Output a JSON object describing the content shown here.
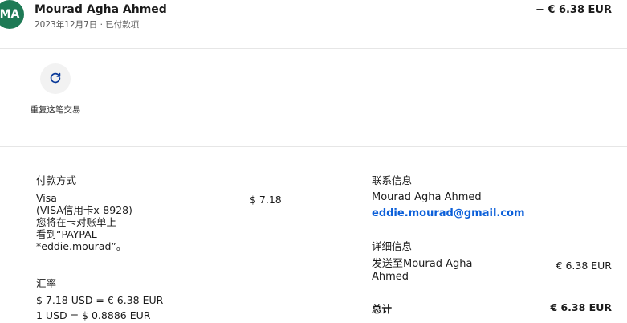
{
  "header": {
    "avatar_initials": "MA",
    "merchant_name": "Mourad Agha Ahmed",
    "meta": "2023年12月7日 · 已付款项",
    "amount": "− € 6.38 EUR"
  },
  "actions": {
    "repeat_label": "重复这笔交易",
    "repeat_icon": "refresh-icon"
  },
  "payment": {
    "title": "付款方式",
    "method_lines": [
      "Visa",
      "(VISA信用卡x-8928)",
      "您将在卡对账单上",
      "看到“PAYPAL",
      "*eddie.mourad”。"
    ],
    "amount": "$ 7.18"
  },
  "exchange": {
    "title": "汇率",
    "line1": "$ 7.18 USD = € 6.38 EUR",
    "line2": "1 USD = $ 0.8886 EUR"
  },
  "contact": {
    "title": "联系信息",
    "name": "Mourad Agha Ahmed",
    "email": "eddie.mourad@gmail.com"
  },
  "details": {
    "title": "详细信息",
    "ship_lines": [
      "发送至Mourad Agha",
      "Ahmed"
    ],
    "ship_amount": "€ 6.38 EUR",
    "total_label": "总计",
    "total_amount": "€ 6.38 EUR"
  },
  "colors": {
    "avatar_bg": "#1e7a55",
    "link": "#0b5fd9"
  }
}
